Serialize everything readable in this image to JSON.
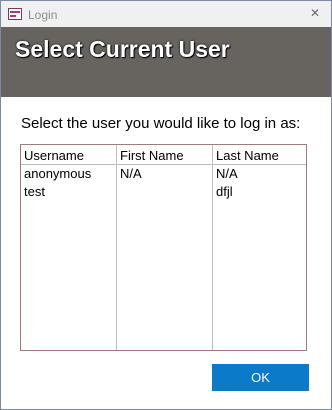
{
  "window": {
    "title": "Login",
    "close_glyph": "✕"
  },
  "header": {
    "title": "Select Current User",
    "band_color": "#676460"
  },
  "prompt": "Select the user you would like to log in as:",
  "user_list": {
    "columns": [
      "Username",
      "First Name",
      "Last Name"
    ],
    "rows": [
      [
        "anonymous",
        "N/A",
        "N/A"
      ],
      [
        "test",
        "",
        "dfjl"
      ]
    ]
  },
  "ok_button": {
    "label": "OK",
    "color": "#0b7ac8"
  }
}
